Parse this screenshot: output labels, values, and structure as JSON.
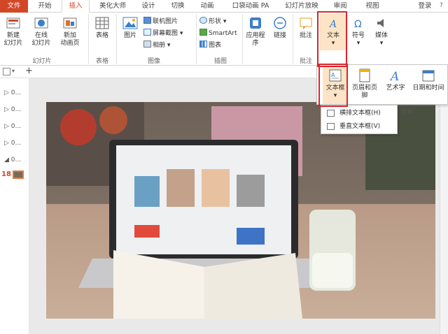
{
  "tabs": [
    "文件",
    "开始",
    "插入",
    "美化大师",
    "设计",
    "切换",
    "动画",
    "口袋动画 PA",
    "幻灯片放映",
    "审阅",
    "视图"
  ],
  "login": "登录",
  "ribbon": {
    "new_slide": "新建\n幻灯片",
    "online_slide": "在线\n幻灯片",
    "new_anim_page": "新加\n动画页",
    "group_slides": "幻灯片",
    "table": "表格",
    "group_tables": "表格",
    "picture": "图片",
    "online_picture": "联机图片",
    "screenshot": "屏幕截图",
    "album": "相册",
    "group_images": "图像",
    "shapes": "形状",
    "smartart": "SmartArt",
    "chart": "图表",
    "group_illustrations": "插图",
    "apps": "应用程\n序",
    "link": "链接",
    "comment": "批注",
    "group_comments": "批注",
    "text": "文本",
    "symbol": "符号",
    "media": "媒体"
  },
  "text_panel": {
    "textbox": "文本框",
    "header_footer": "页眉和页脚",
    "wordart": "艺术字",
    "datetime": "日期和时间",
    "group_label": "文本"
  },
  "textbox_menu": {
    "horizontal": "横排文本框(H)",
    "vertical": "垂直文本框(V)"
  },
  "slides_pane": {
    "items": [
      "0...",
      "0...",
      "0...",
      "0...",
      "0..."
    ],
    "current_number": "18"
  },
  "colors": {
    "accent": "#d24726",
    "highlight_box": "#d9262c",
    "selected_bg": "#fde4c6"
  }
}
